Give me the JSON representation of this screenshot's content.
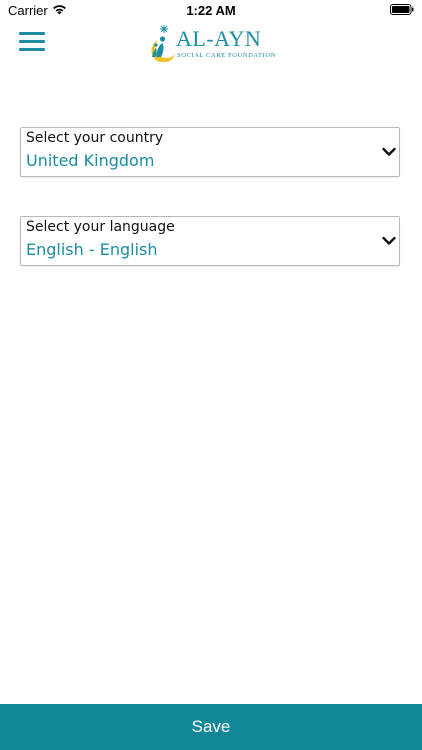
{
  "status_bar": {
    "carrier": "Carrier",
    "time": "1:22 AM"
  },
  "header": {
    "menu_icon": "hamburger-menu-icon",
    "logo": {
      "title": "AL-AYN",
      "subtitle": "SOCIAL CARE FOUNDATION"
    }
  },
  "form": {
    "country": {
      "label": "Select your country",
      "value": "United Kingdom"
    },
    "language": {
      "label": "Select your language",
      "value": "English - English"
    }
  },
  "footer": {
    "save_label": "Save"
  },
  "colors": {
    "accent": "#1b8da0",
    "save_button_bg": "#128797",
    "logo_yellow": "#f2c12e"
  }
}
